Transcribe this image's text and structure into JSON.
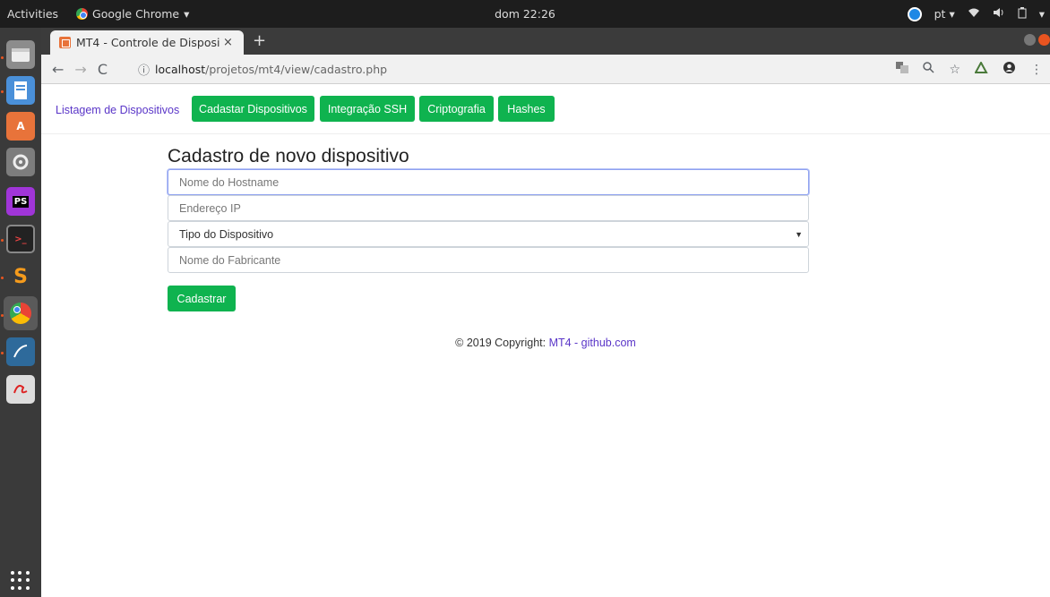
{
  "topbar": {
    "activities": "Activities",
    "app_name": "Google Chrome",
    "app_menu_caret": "▾",
    "clock": "dom 22:26",
    "language": "pt",
    "language_caret": "▾",
    "menu_caret": "▾"
  },
  "dock": {
    "items": [
      {
        "name": "files-icon",
        "color": "#8c8c8c"
      },
      {
        "name": "document-viewer-icon",
        "color": "#4a90d9"
      },
      {
        "name": "software-center-icon",
        "color": "#e8733a"
      },
      {
        "name": "system-settings-icon",
        "color": "#7d7d7d"
      },
      {
        "name": "phpstorm-icon",
        "color": "#a035d8"
      },
      {
        "name": "terminal-icon",
        "color": "#222222"
      },
      {
        "name": "sublime-text-icon",
        "color": "#f59b1c"
      },
      {
        "name": "chrome-icon",
        "color": "#4285f4"
      },
      {
        "name": "mysql-workbench-icon",
        "color": "#2e6a9b"
      },
      {
        "name": "text-editor-icon",
        "color": "#dddddd"
      }
    ]
  },
  "browser": {
    "tab_title": "MT4 - Controle de Disposi",
    "tab_close": "×",
    "new_tab": "+",
    "url_host": "localhost",
    "url_path": "/projetos/mt4/view/cadastro.php"
  },
  "nav": {
    "link_listagem": "Listagem de Dispositivos",
    "btn_cadastrar": "Cadastar Dispositivos",
    "btn_ssh": "Integração SSH",
    "btn_cripto": "Criptografia",
    "btn_hashes": "Hashes"
  },
  "form": {
    "title": "Cadastro de novo dispositivo",
    "hostname_placeholder": "Nome do Hostname",
    "ip_placeholder": "Endereço IP",
    "tipo_selected": "Tipo do Dispositivo",
    "fabricante_placeholder": "Nome do Fabricante",
    "submit_label": "Cadastrar"
  },
  "footer": {
    "text": "© 2019 Copyright: ",
    "link": "MT4 - github.com"
  },
  "colors": {
    "accent_green": "#0fb34f",
    "link_purple": "#5a36c8"
  }
}
